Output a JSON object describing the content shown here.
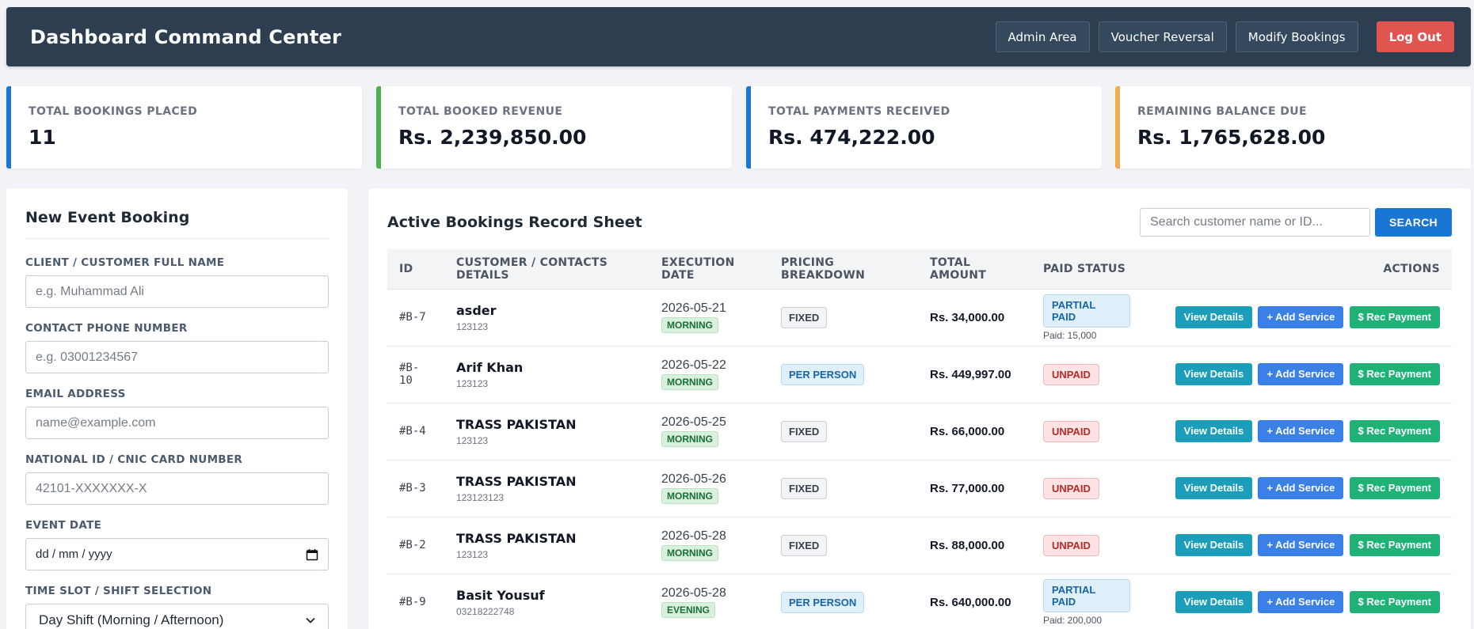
{
  "header": {
    "title": "Dashboard Command Center",
    "nav": [
      "Admin Area",
      "Voucher Reversal",
      "Modify Bookings"
    ],
    "logout_label": "Log Out"
  },
  "stats": [
    {
      "label": "TOTAL BOOKINGS PLACED",
      "value": "11",
      "color": "#1976d2"
    },
    {
      "label": "TOTAL BOOKED REVENUE",
      "value": "Rs. 2,239,850.00",
      "color": "#4caf50"
    },
    {
      "label": "TOTAL PAYMENTS RECEIVED",
      "value": "Rs. 474,222.00",
      "color": "#1976d2"
    },
    {
      "label": "REMAINING BALANCE DUE",
      "value": "Rs. 1,765,628.00",
      "color": "#f0ad4e"
    }
  ],
  "form": {
    "title": "New Event Booking",
    "fields": [
      {
        "label": "CLIENT / CUSTOMER FULL NAME",
        "placeholder": "e.g. Muhammad Ali"
      },
      {
        "label": "CONTACT PHONE NUMBER",
        "placeholder": "e.g. 03001234567"
      },
      {
        "label": "EMAIL ADDRESS",
        "placeholder": "name@example.com"
      },
      {
        "label": "NATIONAL ID / CNIC CARD NUMBER",
        "placeholder": "42101-XXXXXXX-X"
      }
    ],
    "date_label": "EVENT DATE",
    "date_placeholder": "dd / mm / yyyy",
    "shift_label": "TIME SLOT / SHIFT SELECTION",
    "shift_value": "Day Shift (Morning / Afternoon)"
  },
  "table": {
    "title": "Active Bookings Record Sheet",
    "search_placeholder": "Search customer name or ID...",
    "search_label": "SEARCH",
    "columns": [
      "ID",
      "CUSTOMER / CONTACTS DETAILS",
      "EXECUTION DATE",
      "PRICING BREAKDOWN",
      "TOTAL AMOUNT",
      "PAID STATUS",
      "ACTIONS"
    ],
    "action_labels": {
      "view": "View Details",
      "add": "+ Add Service",
      "pay": "$ Rec Payment"
    },
    "rows": [
      {
        "id": "#B-7",
        "name": "asder",
        "phone": "123123",
        "date": "2026-05-21",
        "shift": "MORNING",
        "pricing": "FIXED",
        "amount": "Rs. 34,000.00",
        "status": "PARTIAL PAID",
        "paid": "Paid: 15,000"
      },
      {
        "id": "#B-10",
        "name": "Arif Khan",
        "phone": "123123",
        "date": "2026-05-22",
        "shift": "MORNING",
        "pricing": "PER PERSON",
        "amount": "Rs. 449,997.00",
        "status": "UNPAID",
        "paid": ""
      },
      {
        "id": "#B-4",
        "name": "TRASS PAKISTAN",
        "phone": "123123",
        "date": "2026-05-25",
        "shift": "MORNING",
        "pricing": "FIXED",
        "amount": "Rs. 66,000.00",
        "status": "UNPAID",
        "paid": ""
      },
      {
        "id": "#B-3",
        "name": "TRASS PAKISTAN",
        "phone": "123123123",
        "date": "2026-05-26",
        "shift": "MORNING",
        "pricing": "FIXED",
        "amount": "Rs. 77,000.00",
        "status": "UNPAID",
        "paid": ""
      },
      {
        "id": "#B-2",
        "name": "TRASS PAKISTAN",
        "phone": "123123",
        "date": "2026-05-28",
        "shift": "MORNING",
        "pricing": "FIXED",
        "amount": "Rs. 88,000.00",
        "status": "UNPAID",
        "paid": ""
      },
      {
        "id": "#B-9",
        "name": "Basit Yousuf",
        "phone": "03218222748",
        "date": "2026-05-28",
        "shift": "EVENING",
        "pricing": "PER PERSON",
        "amount": "Rs. 640,000.00",
        "status": "PARTIAL PAID",
        "paid": "Paid: 200,000"
      }
    ]
  }
}
